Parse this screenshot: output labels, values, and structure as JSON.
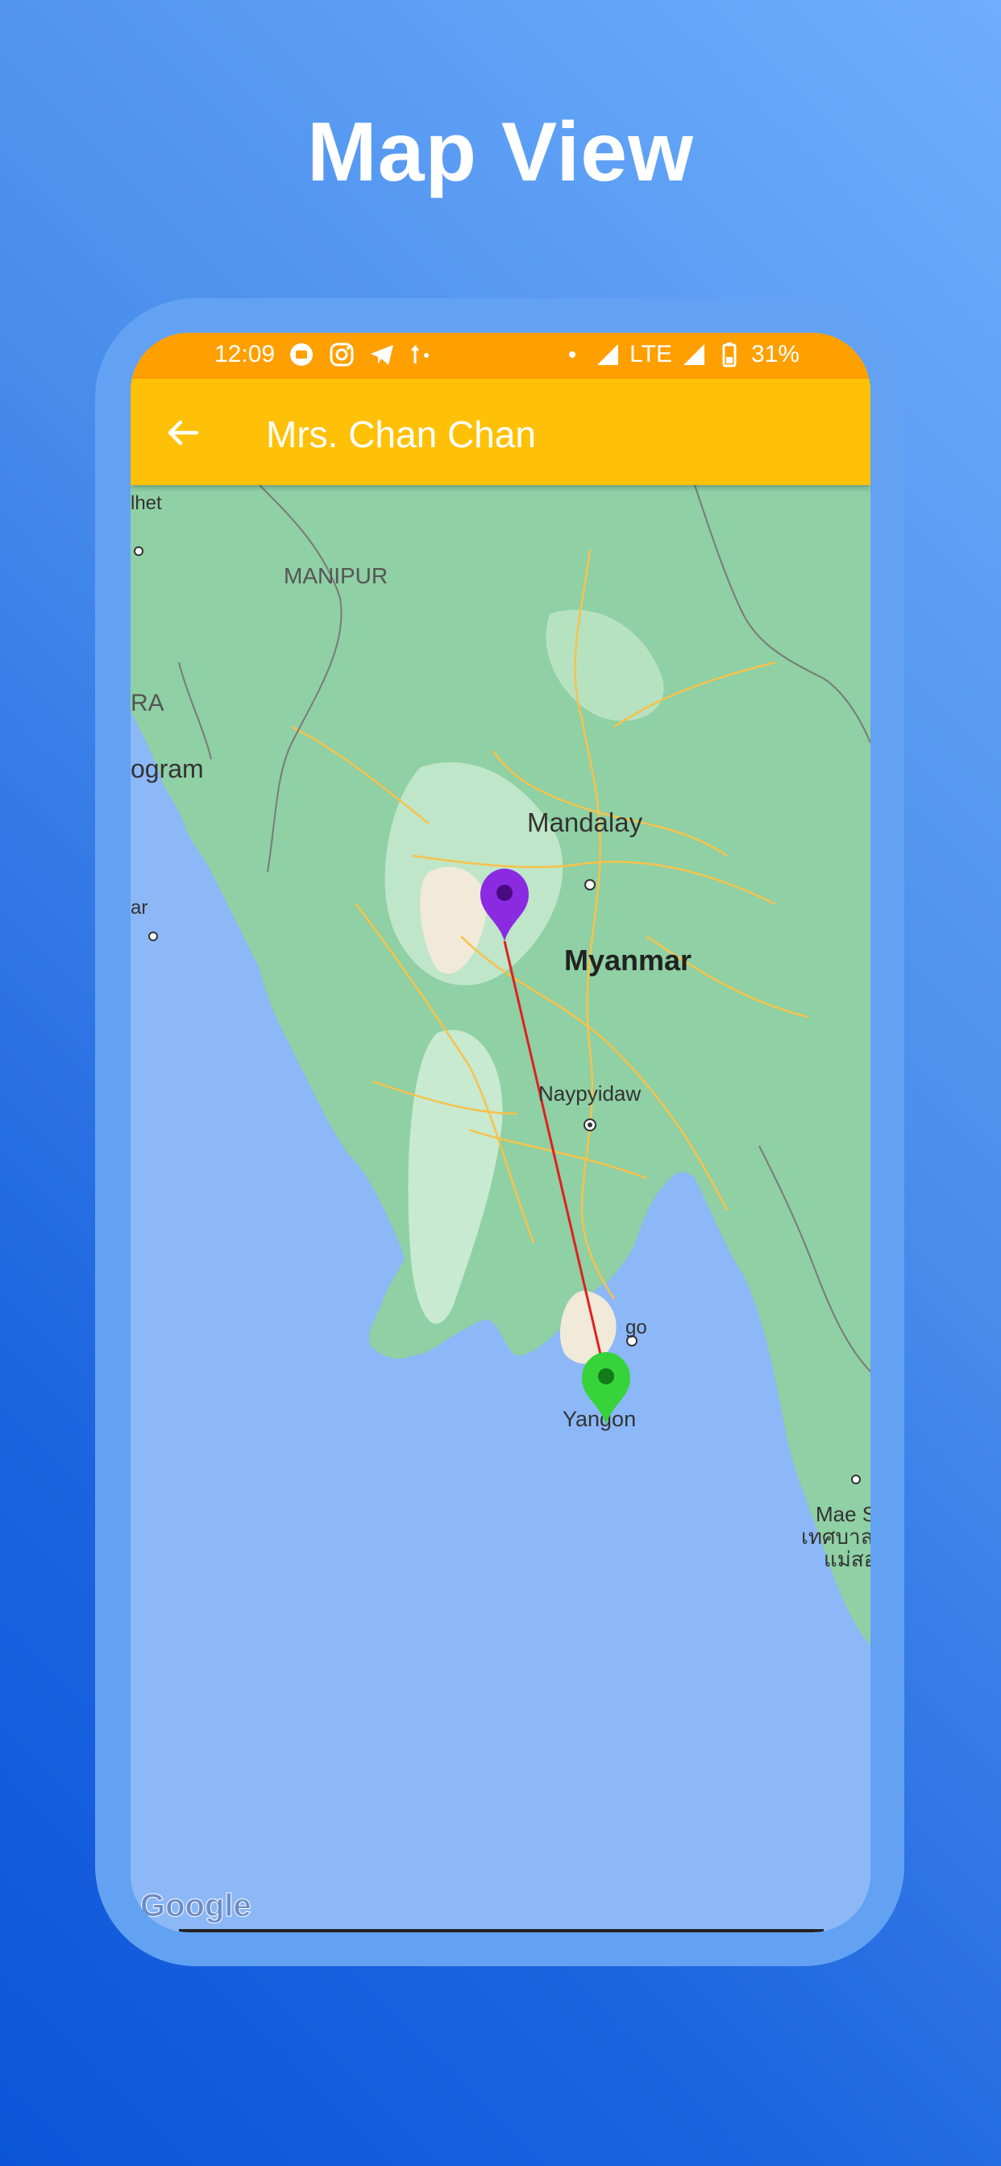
{
  "headline": "Map View",
  "status_bar": {
    "time": "12:09",
    "network": "LTE",
    "battery": "31%"
  },
  "app_bar": {
    "title": "Mrs. Chan Chan",
    "back_icon": "arrow-left-icon"
  },
  "map": {
    "labels": {
      "sylhet_partial": "lhet",
      "manipur": "MANIPUR",
      "chittagong_partial": "ogram",
      "tripura_partial": "RA",
      "edge_partial": "ar",
      "mandalay": "Mandalay",
      "myanmar": "Myanmar",
      "naypyidaw": "Naypyidaw",
      "bago_partial": "go",
      "yangon": "Yangon",
      "mae_sot_partial": "Mae S",
      "thai_1": "เทศบาล",
      "thai_2": "แม่สอ"
    },
    "markers": [
      {
        "name": "origin",
        "color": "#8a2be2"
      },
      {
        "name": "destination",
        "color": "#37d33a"
      }
    ],
    "route_color": "#e02020",
    "attribution": "Google"
  }
}
